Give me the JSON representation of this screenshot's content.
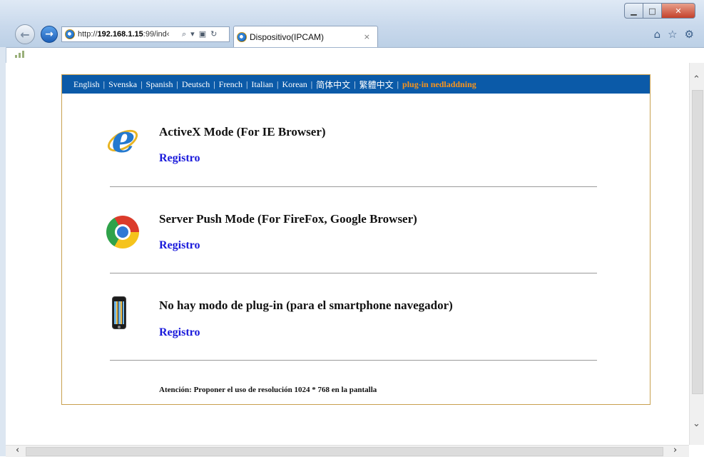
{
  "browser": {
    "url_prefix": "http://",
    "url_host": "192.168.1.15",
    "url_rest": ":99/ind‹",
    "tab_title": "Dispositivo(IPCAM)",
    "tab_close": "×",
    "back_icon": "back-arrow",
    "forward_icon": "forward-arrow"
  },
  "languages": [
    {
      "label": "English"
    },
    {
      "label": "Svenska"
    },
    {
      "label": "Spanish"
    },
    {
      "label": "Deutsch"
    },
    {
      "label": "French"
    },
    {
      "label": "Italian"
    },
    {
      "label": "Korean"
    },
    {
      "label": "简体中文"
    },
    {
      "label": "繁體中文"
    },
    {
      "label": "plug-in nedladdning"
    }
  ],
  "modes": [
    {
      "title": "ActiveX Mode (For IE Browser)",
      "link": "Registro",
      "icon": "internet-explorer-icon"
    },
    {
      "title": "Server Push Mode (For FireFox, Google Browser)",
      "link": "Registro",
      "icon": "chrome-icon"
    },
    {
      "title": "No hay modo de plug-in (para el smartphone navegador)",
      "link": "Registro",
      "icon": "smartphone-icon"
    }
  ],
  "notice": "Atención: Proponer el uso de resolución 1024 * 768 en la pantalla",
  "colors": {
    "langbar": "#0b5aa8",
    "active_lang": "#f7941d",
    "link": "#1a1adb",
    "panel_border": "#c8a04e"
  }
}
